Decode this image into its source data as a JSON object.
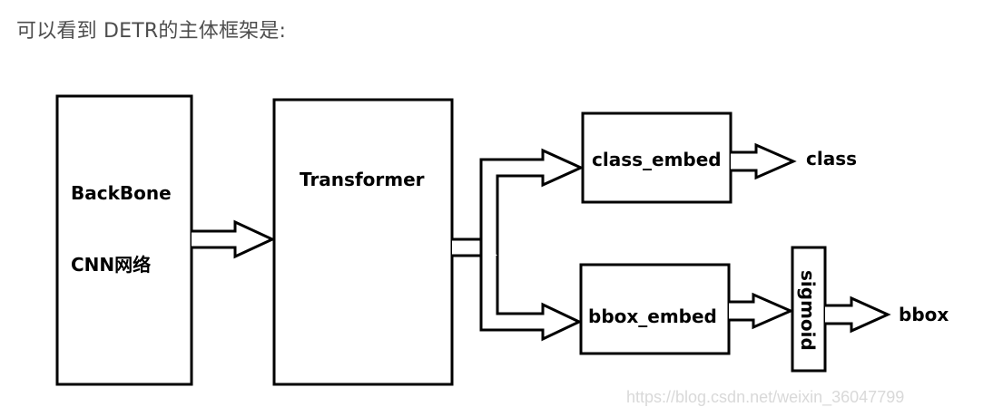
{
  "intro_text": "可以看到 DETR的主体框架是:",
  "nodes": {
    "backbone_line1": "BackBone",
    "backbone_line2": "CNN网络",
    "transformer": "Transformer",
    "class_embed": "class_embed",
    "bbox_embed": "bbox_embed",
    "sigmoid": "sigmoid"
  },
  "outputs": {
    "class": "class",
    "bbox": "bbox"
  },
  "watermark": "https://blog.csdn.net/weixin_36047799"
}
